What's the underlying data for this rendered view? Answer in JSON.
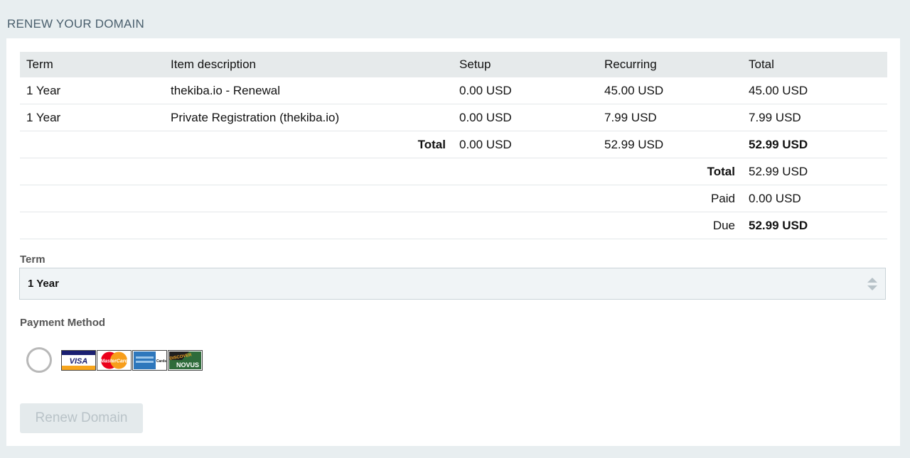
{
  "page": {
    "heading": "RENEW YOUR DOMAIN"
  },
  "table": {
    "headers": {
      "term": "Term",
      "item": "Item description",
      "setup": "Setup",
      "recurring": "Recurring",
      "total": "Total"
    },
    "rows": [
      {
        "term": "1 Year",
        "item": "thekiba.io - Renewal",
        "setup": "0.00 USD",
        "recurring": "45.00 USD",
        "total": "45.00 USD"
      },
      {
        "term": "1 Year",
        "item": "Private Registration (thekiba.io)",
        "setup": "0.00 USD",
        "recurring": "7.99 USD",
        "total": "7.99 USD"
      }
    ],
    "subtotal": {
      "label": "Total",
      "setup": "0.00 USD",
      "recurring": "52.99 USD",
      "total": "52.99 USD"
    },
    "summary": {
      "total": {
        "label": "Total",
        "value": "52.99 USD"
      },
      "paid": {
        "label": "Paid",
        "value": "0.00 USD"
      },
      "due": {
        "label": "Due",
        "value": "52.99 USD"
      }
    }
  },
  "term_select": {
    "label": "Term",
    "value": "1 Year"
  },
  "payment": {
    "label": "Payment Method",
    "cards": {
      "visa": "VISA",
      "mastercard": "MasterCard",
      "amex": "Cards",
      "discover": "DISCOVER",
      "novus": "NOVUS"
    },
    "colors": {
      "visa_blue": "#1a1f71",
      "visa_gold": "#f7a51c",
      "mastercard_red": "#eb001b",
      "mastercard_orange": "#f79e1b",
      "amex_blue": "#2e77bc",
      "discover_green": "#2e6b3a"
    }
  },
  "actions": {
    "renew_label": "Renew Domain"
  }
}
